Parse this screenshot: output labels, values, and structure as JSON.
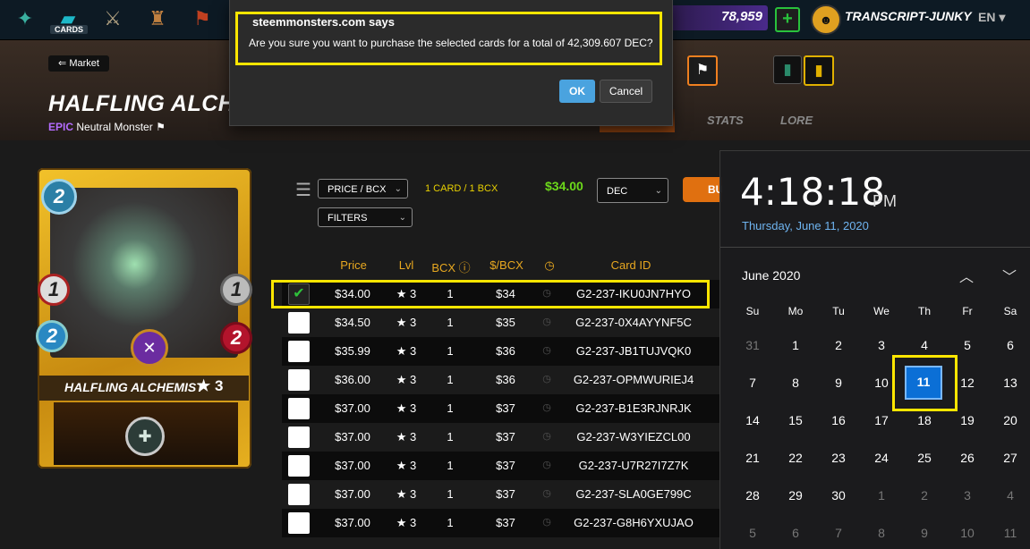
{
  "topbar": {
    "cards_label": "CARDS",
    "dec_amount": "78,959",
    "plus_label": "+",
    "username": "TRANSCRIPT-JUNKY",
    "language": "EN"
  },
  "header": {
    "back_label": "Market",
    "card_title": "HALFLING ALCHEM",
    "rarity": "EPIC",
    "type": "Neutral Monster",
    "tabs": {
      "stats": "STATS",
      "lore": "LORE"
    }
  },
  "card": {
    "name": "HALFLING ALCHEMIST",
    "level": "★ 3",
    "mana": "2",
    "attack": "1",
    "armor": "1",
    "speed": "2",
    "health": "2"
  },
  "controls": {
    "sort_dropdown": "PRICE / BCX",
    "filters_dropdown": "FILTERS",
    "card_bcx": "1 CARD / 1 BCX",
    "total_price": "$34.00",
    "currency": "DEC",
    "buy_label": "BUY"
  },
  "table": {
    "headers": [
      "Price",
      "Lvl",
      "BCX",
      "$/BCX",
      "Card ID"
    ],
    "rows": [
      {
        "price": "$34.00",
        "lvl": "★ 3",
        "bcx": "1",
        "per": "$34",
        "id": "G2-237-IKU0JN7HYO",
        "checked": true
      },
      {
        "price": "$34.50",
        "lvl": "★ 3",
        "bcx": "1",
        "per": "$35",
        "id": "G2-237-0X4AYYNF5C",
        "checked": false
      },
      {
        "price": "$35.99",
        "lvl": "★ 3",
        "bcx": "1",
        "per": "$36",
        "id": "G2-237-JB1TUJVQK0",
        "checked": false
      },
      {
        "price": "$36.00",
        "lvl": "★ 3",
        "bcx": "1",
        "per": "$36",
        "id": "G2-237-OPMWURIEJ4",
        "checked": false
      },
      {
        "price": "$37.00",
        "lvl": "★ 3",
        "bcx": "1",
        "per": "$37",
        "id": "G2-237-B1E3RJNRJK",
        "checked": false
      },
      {
        "price": "$37.00",
        "lvl": "★ 3",
        "bcx": "1",
        "per": "$37",
        "id": "G2-237-W3YIEZCL00",
        "checked": false
      },
      {
        "price": "$37.00",
        "lvl": "★ 3",
        "bcx": "1",
        "per": "$37",
        "id": "G2-237-U7R27I7Z7K",
        "checked": false
      },
      {
        "price": "$37.00",
        "lvl": "★ 3",
        "bcx": "1",
        "per": "$37",
        "id": "G2-237-SLA0GE799C",
        "checked": false
      },
      {
        "price": "$37.00",
        "lvl": "★ 3",
        "bcx": "1",
        "per": "$37",
        "id": "G2-237-G8H6YXUJAO",
        "checked": false
      }
    ]
  },
  "dialog": {
    "title": "steemmonsters.com says",
    "message": "Are you sure you want to purchase the selected cards for a total of 42,309.607 DEC?",
    "ok": "OK",
    "cancel": "Cancel"
  },
  "clock": {
    "time": "4:18:18",
    "ampm": "PM",
    "date": "Thursday, June 11, 2020",
    "month": "June 2020",
    "weekdays": [
      "Su",
      "Mo",
      "Tu",
      "We",
      "Th",
      "Fr",
      "Sa"
    ],
    "weeks": [
      [
        "31",
        "1",
        "2",
        "3",
        "4",
        "5",
        "6"
      ],
      [
        "7",
        "8",
        "9",
        "10",
        "11",
        "12",
        "13"
      ],
      [
        "14",
        "15",
        "16",
        "17",
        "18",
        "19",
        "20"
      ],
      [
        "21",
        "22",
        "23",
        "24",
        "25",
        "26",
        "27"
      ],
      [
        "28",
        "29",
        "30",
        "1",
        "2",
        "3",
        "4"
      ],
      [
        "5",
        "6",
        "7",
        "8",
        "9",
        "10",
        "11"
      ]
    ],
    "today": "11"
  },
  "colors": {
    "accent_gold": "#e8a820",
    "highlight_yellow": "#ffe600",
    "price_green": "#6cd91a",
    "ok_blue": "#4aa3df",
    "today_blue": "#0b6fd6"
  }
}
